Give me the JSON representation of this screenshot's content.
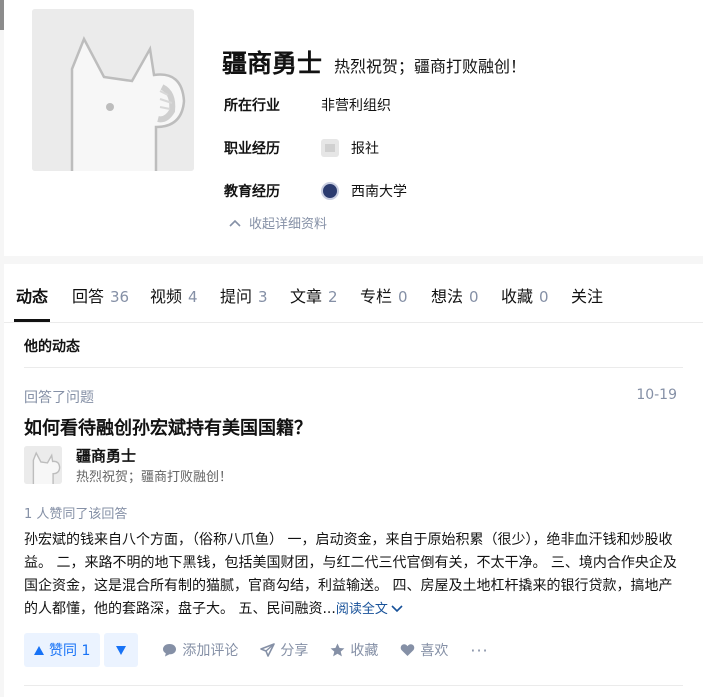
{
  "profile": {
    "name": "疆商勇士",
    "headline": "热烈祝贺；疆商打败融创！",
    "info": [
      {
        "label": "所在行业",
        "value": "非营利组织",
        "logo": "none"
      },
      {
        "label": "职业经历",
        "value": "报社",
        "logo": "company-logo-icon"
      },
      {
        "label": "教育经历",
        "value": "西南大学",
        "logo": "school-logo-icon"
      }
    ],
    "collapse_label": "收起详细资料"
  },
  "tabs": [
    {
      "label": "动态",
      "count": ""
    },
    {
      "label": "回答",
      "count": "36"
    },
    {
      "label": "视频",
      "count": "4"
    },
    {
      "label": "提问",
      "count": "3"
    },
    {
      "label": "文章",
      "count": "2"
    },
    {
      "label": "专栏",
      "count": "0"
    },
    {
      "label": "想法",
      "count": "0"
    },
    {
      "label": "收藏",
      "count": "0"
    },
    {
      "label": "关注",
      "count": ""
    }
  ],
  "feed": {
    "section_title": "他的动态",
    "item": {
      "action": "回答了问题",
      "date": "10-19",
      "question_title": "如何看待融创孙宏斌持有美国国籍？",
      "author_name": "疆商勇士",
      "author_headline": "热烈祝贺；疆商打败融创！",
      "votes_text": "1 人赞同了该回答",
      "excerpt": "孙宏斌的钱来自八个方面，（俗称八爪鱼） 一，启动资金，来自于原始积累（很少），绝非血汗钱和炒股收益。 二，来路不明的地下黑钱，包括美国财团，与红二代三代官倒有关，不太干净。 三、境内合作央企及国企资金，这是混合所有制的猫腻，官商勾结，利益输送。 四、房屋及土地杠杆撬来的银行贷款，搞地产的人都懂，他的套路深，盘子大。 五、民间融资...",
      "read_more": "阅读全文",
      "actions": {
        "upvote": "赞同 1",
        "comment": "添加评论",
        "share": "分享",
        "favorite": "收藏",
        "like": "喜欢"
      }
    }
  },
  "colors": {
    "accent": "#1772f6",
    "accent_bg": "#ebf3ff",
    "muted": "#8590a6",
    "link": "#175199",
    "cover": "#8c8c8c"
  }
}
